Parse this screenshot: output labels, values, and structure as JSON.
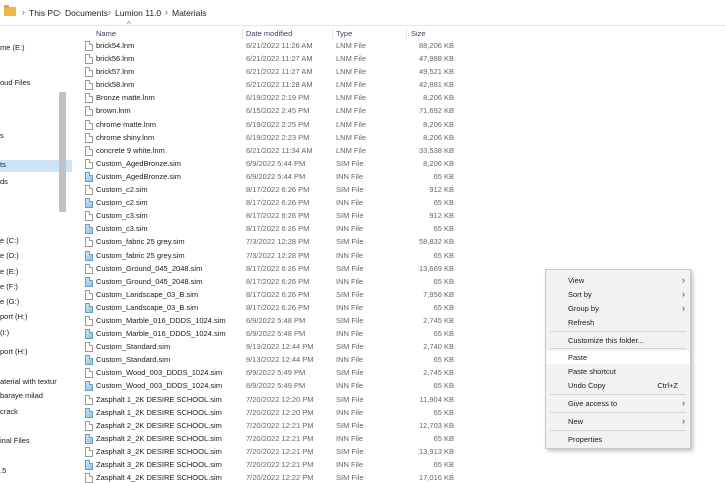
{
  "breadcrumb": [
    "This PC",
    "Documents",
    "Lumion 11.0",
    "Materials"
  ],
  "columns": {
    "name": "Name",
    "date": "Date modified",
    "type": "Type",
    "size": "Size"
  },
  "nav": [
    {
      "label": "me (E:)"
    },
    {
      "label": "oud Files"
    },
    {
      "label": "s"
    },
    {
      "label": "ts",
      "selected": true
    },
    {
      "label": "ds"
    },
    {
      "label": "e (C:)"
    },
    {
      "label": "e (D:)"
    },
    {
      "label": "e (E:)"
    },
    {
      "label": "e (F:)"
    },
    {
      "label": "e (G:)"
    },
    {
      "label": "port (H:)"
    },
    {
      "label": "(I:)"
    },
    {
      "label": "port (H:)"
    },
    {
      "label": "aterial with textur"
    },
    {
      "label": "baraye milad"
    },
    {
      "label": "crack"
    },
    {
      "label": "inal Files"
    },
    {
      "label": ".5"
    }
  ],
  "files": [
    {
      "name": "brick54.lnm",
      "date": "6/21/2022 11:26 AM",
      "type": "LNM File",
      "size": "88,206 KB"
    },
    {
      "name": "brick56.lnm",
      "date": "6/21/2022 11:27 AM",
      "type": "LNM File",
      "size": "47,988 KB"
    },
    {
      "name": "brick57.lnm",
      "date": "6/21/2022 11:27 AM",
      "type": "LNM File",
      "size": "49,521 KB"
    },
    {
      "name": "brick58.lnm",
      "date": "6/21/2022 11:28 AM",
      "type": "LNM File",
      "size": "42,881 KB"
    },
    {
      "name": "Bronze matte.lnm",
      "date": "6/19/2022 2:19 PM",
      "type": "LNM File",
      "size": "8,206 KB"
    },
    {
      "name": "brown.lnm",
      "date": "6/15/2022 2:45 PM",
      "type": "LNM File",
      "size": "71,692 KB"
    },
    {
      "name": "chrome matte.lnm",
      "date": "6/19/2022 2:25 PM",
      "type": "LNM File",
      "size": "8,206 KB"
    },
    {
      "name": "chrome shiny.lnm",
      "date": "6/19/2022 2:23 PM",
      "type": "LNM File",
      "size": "8,206 KB"
    },
    {
      "name": "concrete 9 white.lnm",
      "date": "6/21/2022 11:34 AM",
      "type": "LNM File",
      "size": "33,538 KB"
    },
    {
      "name": "Custom_AgedBronze.sim",
      "date": "6/9/2022 5:44 PM",
      "type": "SIM File",
      "size": "8,206 KB"
    },
    {
      "name": "Custom_AgedBronze.sim",
      "date": "6/9/2022 5:44 PM",
      "type": "INN File",
      "size": "65 KB",
      "inn": true
    },
    {
      "name": "Custom_c2.sim",
      "date": "8/17/2022 6:26 PM",
      "type": "SIM File",
      "size": "912 KB"
    },
    {
      "name": "Custom_c2.sim",
      "date": "8/17/2022 6:26 PM",
      "type": "INN File",
      "size": "65 KB",
      "inn": true
    },
    {
      "name": "Custom_c3.sim",
      "date": "8/17/2022 6:26 PM",
      "type": "SIM File",
      "size": "912 KB"
    },
    {
      "name": "Custom_c3.sim",
      "date": "8/17/2022 6:26 PM",
      "type": "INN File",
      "size": "65 KB",
      "inn": true
    },
    {
      "name": "Custom_fabric 25 grey.sim",
      "date": "7/3/2022 12:28 PM",
      "type": "SIM File",
      "size": "58,832 KB"
    },
    {
      "name": "Custom_fabric 25 grey.sim",
      "date": "7/3/2022 12:28 PM",
      "type": "INN File",
      "size": "65 KB",
      "inn": true
    },
    {
      "name": "Custom_Ground_045_2048.sim",
      "date": "8/17/2022 6:26 PM",
      "type": "SIM File",
      "size": "13,669 KB"
    },
    {
      "name": "Custom_Ground_045_2048.sim",
      "date": "8/17/2022 6:26 PM",
      "type": "INN File",
      "size": "65 KB",
      "inn": true
    },
    {
      "name": "Custom_Landscape_03_B.sim",
      "date": "8/17/2022 6:26 PM",
      "type": "SIM File",
      "size": "7,956 KB"
    },
    {
      "name": "Custom_Landscape_03_B.sim",
      "date": "8/17/2022 6:26 PM",
      "type": "INN File",
      "size": "65 KB",
      "inn": true
    },
    {
      "name": "Custom_Marble_016_DDDS_1024.sim",
      "date": "6/9/2022 5:48 PM",
      "type": "SIM File",
      "size": "2,745 KB"
    },
    {
      "name": "Custom_Marble_016_DDDS_1024.sim",
      "date": "6/9/2022 5:48 PM",
      "type": "INN File",
      "size": "65 KB",
      "inn": true
    },
    {
      "name": "Custom_Standard.sim",
      "date": "9/13/2022 12:44 PM",
      "type": "SIM File",
      "size": "2,740 KB"
    },
    {
      "name": "Custom_Standard.sim",
      "date": "9/13/2022 12:44 PM",
      "type": "INN File",
      "size": "65 KB",
      "inn": true
    },
    {
      "name": "Custom_Wood_003_DDDS_1024.sim",
      "date": "6/9/2022 5:49 PM",
      "type": "SIM File",
      "size": "2,745 KB"
    },
    {
      "name": "Custom_Wood_003_DDDS_1024.sim",
      "date": "6/9/2022 5:49 PM",
      "type": "INN File",
      "size": "65 KB",
      "inn": true
    },
    {
      "name": "Zasphalt 1_2K DESIRE SCHOOL.sim",
      "date": "7/20/2022 12:20 PM",
      "type": "SIM File",
      "size": "11,904 KB"
    },
    {
      "name": "Zasphalt 1_2K DESIRE SCHOOL.sim",
      "date": "7/20/2022 12:20 PM",
      "type": "INN File",
      "size": "65 KB",
      "inn": true
    },
    {
      "name": "Zasphalt 2_2K DESIRE SCHOOL.sim",
      "date": "7/20/2022 12:21 PM",
      "type": "SIM File",
      "size": "12,703 KB"
    },
    {
      "name": "Zasphalt 2_2K DESIRE SCHOOL.sim",
      "date": "7/20/2022 12:21 PM",
      "type": "INN File",
      "size": "65 KB",
      "inn": true
    },
    {
      "name": "Zasphalt 3_2K DESIRE SCHOOL.sim",
      "date": "7/20/2022 12:21 PM",
      "type": "SIM File",
      "size": "13,913 KB"
    },
    {
      "name": "Zasphalt 3_2K DESIRE SCHOOL.sim",
      "date": "7/20/2022 12:21 PM",
      "type": "INN File",
      "size": "65 KB",
      "inn": true
    },
    {
      "name": "Zasphalt 4_2K DESIRE SCHOOL.sim",
      "date": "7/20/2022 12:22 PM",
      "type": "SIM File",
      "size": "17,016 KB"
    }
  ],
  "context_menu": {
    "view": "View",
    "sort_by": "Sort by",
    "group_by": "Group by",
    "refresh": "Refresh",
    "customize": "Customize this folder...",
    "paste": "Paste",
    "paste_shortcut": "Paste shortcut",
    "undo_copy": "Undo Copy",
    "undo_shortcut": "Ctrl+Z",
    "give_access": "Give access to",
    "new": "New",
    "properties": "Properties"
  },
  "icons": {
    "arrow": "›",
    "sort": "^",
    "chevron": "›"
  }
}
